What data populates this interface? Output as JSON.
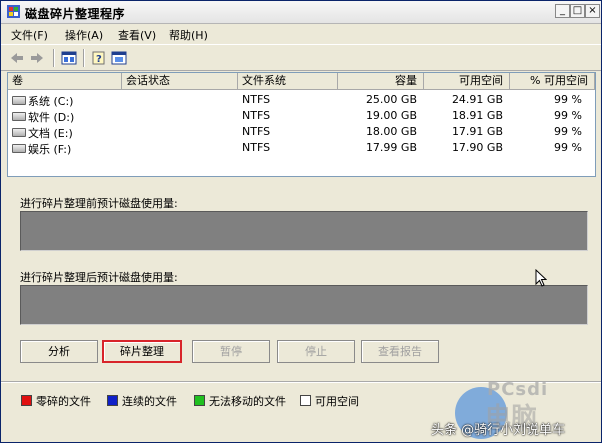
{
  "window": {
    "title": "磁盘碎片整理程序",
    "controls": {
      "minimize": "_",
      "maximize": "□",
      "close": "×"
    }
  },
  "menu": [
    {
      "label": "文件(F)"
    },
    {
      "label": "操作(A)"
    },
    {
      "label": "查看(V)"
    },
    {
      "label": "帮助(H)"
    }
  ],
  "toolbar": {
    "icons": [
      "back-arrow-icon",
      "forward-arrow-icon",
      "properties-icon",
      "help-icon",
      "view-icon"
    ]
  },
  "volume_table": {
    "columns": [
      "卷",
      "会话状态",
      "文件系统",
      "容量",
      "可用空间",
      "% 可用空间"
    ],
    "rows": [
      {
        "volume": "系统 (C:)",
        "session": "",
        "fs": "NTFS",
        "capacity": "25.00 GB",
        "free": "24.91 GB",
        "pct": "99 %"
      },
      {
        "volume": "软件 (D:)",
        "session": "",
        "fs": "NTFS",
        "capacity": "19.00 GB",
        "free": "18.91 GB",
        "pct": "99 %"
      },
      {
        "volume": "文档 (E:)",
        "session": "",
        "fs": "NTFS",
        "capacity": "18.00 GB",
        "free": "17.91 GB",
        "pct": "99 %"
      },
      {
        "volume": "娱乐 (F:)",
        "session": "",
        "fs": "NTFS",
        "capacity": "17.99 GB",
        "free": "17.90 GB",
        "pct": "99 %"
      }
    ]
  },
  "panels": {
    "before_label": "进行碎片整理前预计磁盘使用量:",
    "after_label": "进行碎片整理后预计磁盘使用量:"
  },
  "buttons": {
    "analyze": "分析",
    "defragment": "碎片整理",
    "pause": "暂停",
    "stop": "停止",
    "view_report": "查看报告"
  },
  "legend": [
    {
      "label": "零碎的文件",
      "color": "#e01010"
    },
    {
      "label": "连续的文件",
      "color": "#1020c8"
    },
    {
      "label": "无法移动的文件",
      "color": "#20c020"
    },
    {
      "label": "可用空间",
      "color": "#ffffff"
    }
  ],
  "watermark": {
    "credit": "头条 @骑行小刘说单车"
  }
}
